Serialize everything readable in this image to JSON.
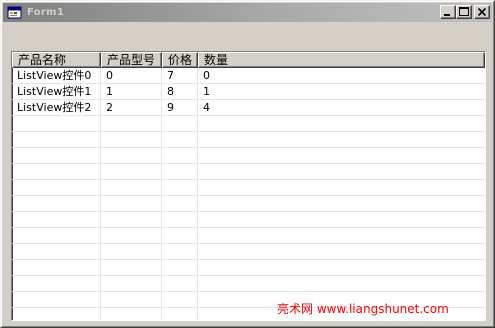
{
  "window": {
    "title": "Form1",
    "minimize_label": "_",
    "maximize_label": "□",
    "close_label": "×"
  },
  "listview": {
    "columns": [
      "产品名称",
      "产品型号",
      "价格",
      "数量"
    ],
    "rows": [
      [
        "ListView控件0",
        "0",
        "7",
        "0"
      ],
      [
        "ListView控件1",
        "1",
        "8",
        "1"
      ],
      [
        "ListView控件2",
        "2",
        "9",
        "4"
      ]
    ]
  },
  "watermark": "亮术网 www.liangshunet.com",
  "colors": {
    "watermark": "#ff0000",
    "titlebar_inactive_start": "#808080",
    "titlebar_inactive_end": "#c0c0c0",
    "face": "#d4d0c8",
    "gridline": "#e6e6e6"
  }
}
